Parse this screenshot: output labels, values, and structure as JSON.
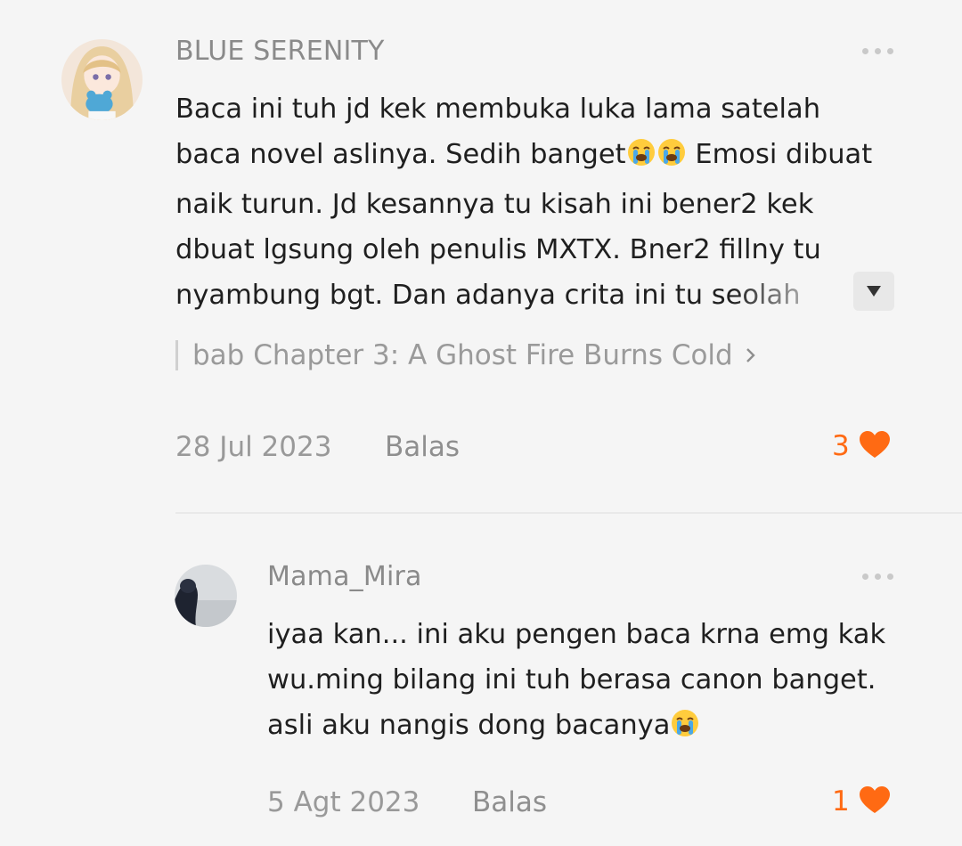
{
  "colors": {
    "accent": "#ff6a13",
    "background": "#f5f5f5",
    "muted_text": "#999999",
    "body_text": "#1f1f1f"
  },
  "comments": [
    {
      "username": "BLUE SERENITY",
      "text_lines": [
        "Baca ini tuh jd kek membuka luka lama satelah",
        "baca novel aslinya. Sedih banget",
        " Emosi dibuat",
        "naik turun. Jd kesannya tu kisah ini bener2 kek",
        "dbuat lgsung oleh penulis MXTX. Bner2 fillny tu",
        "nyambung bgt. Dan adanya crita ini tu seolah"
      ],
      "emoji": "loudly-crying-face",
      "chapter": "bab Chapter 3: A Ghost Fire Burns Cold",
      "date": "28 Jul 2023",
      "reply_label": "Balas",
      "likes": "3"
    },
    {
      "username": "Mama_Mira",
      "text_lines": [
        "iyaa kan... ini aku pengen baca krna emg kak",
        "wu.ming bilang ini tuh berasa canon banget.",
        "asli aku nangis dong bacanya"
      ],
      "emoji": "loudly-crying-face",
      "date": "5 Agt 2023",
      "reply_label": "Balas",
      "likes": "1"
    }
  ]
}
